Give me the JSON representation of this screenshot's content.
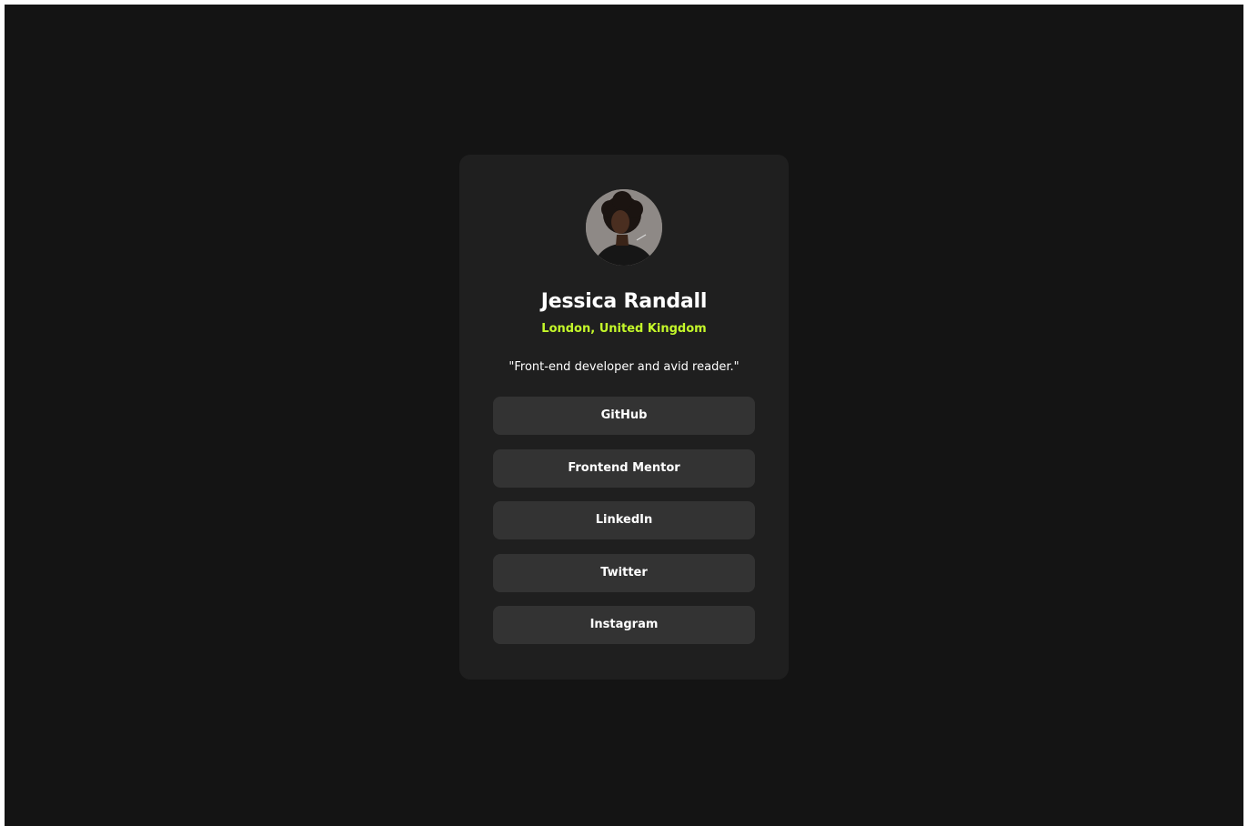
{
  "profile": {
    "name": "Jessica Randall",
    "location": "London, United Kingdom",
    "bio": "\"Front-end developer and avid reader.\"",
    "accent_color": "#c4f82a"
  },
  "links": [
    {
      "label": "GitHub"
    },
    {
      "label": "Frontend Mentor"
    },
    {
      "label": "LinkedIn"
    },
    {
      "label": "Twitter"
    },
    {
      "label": "Instagram"
    }
  ],
  "colors": {
    "background": "#141414",
    "card": "#1f1f1f",
    "button": "#333333",
    "text": "#ffffff"
  }
}
